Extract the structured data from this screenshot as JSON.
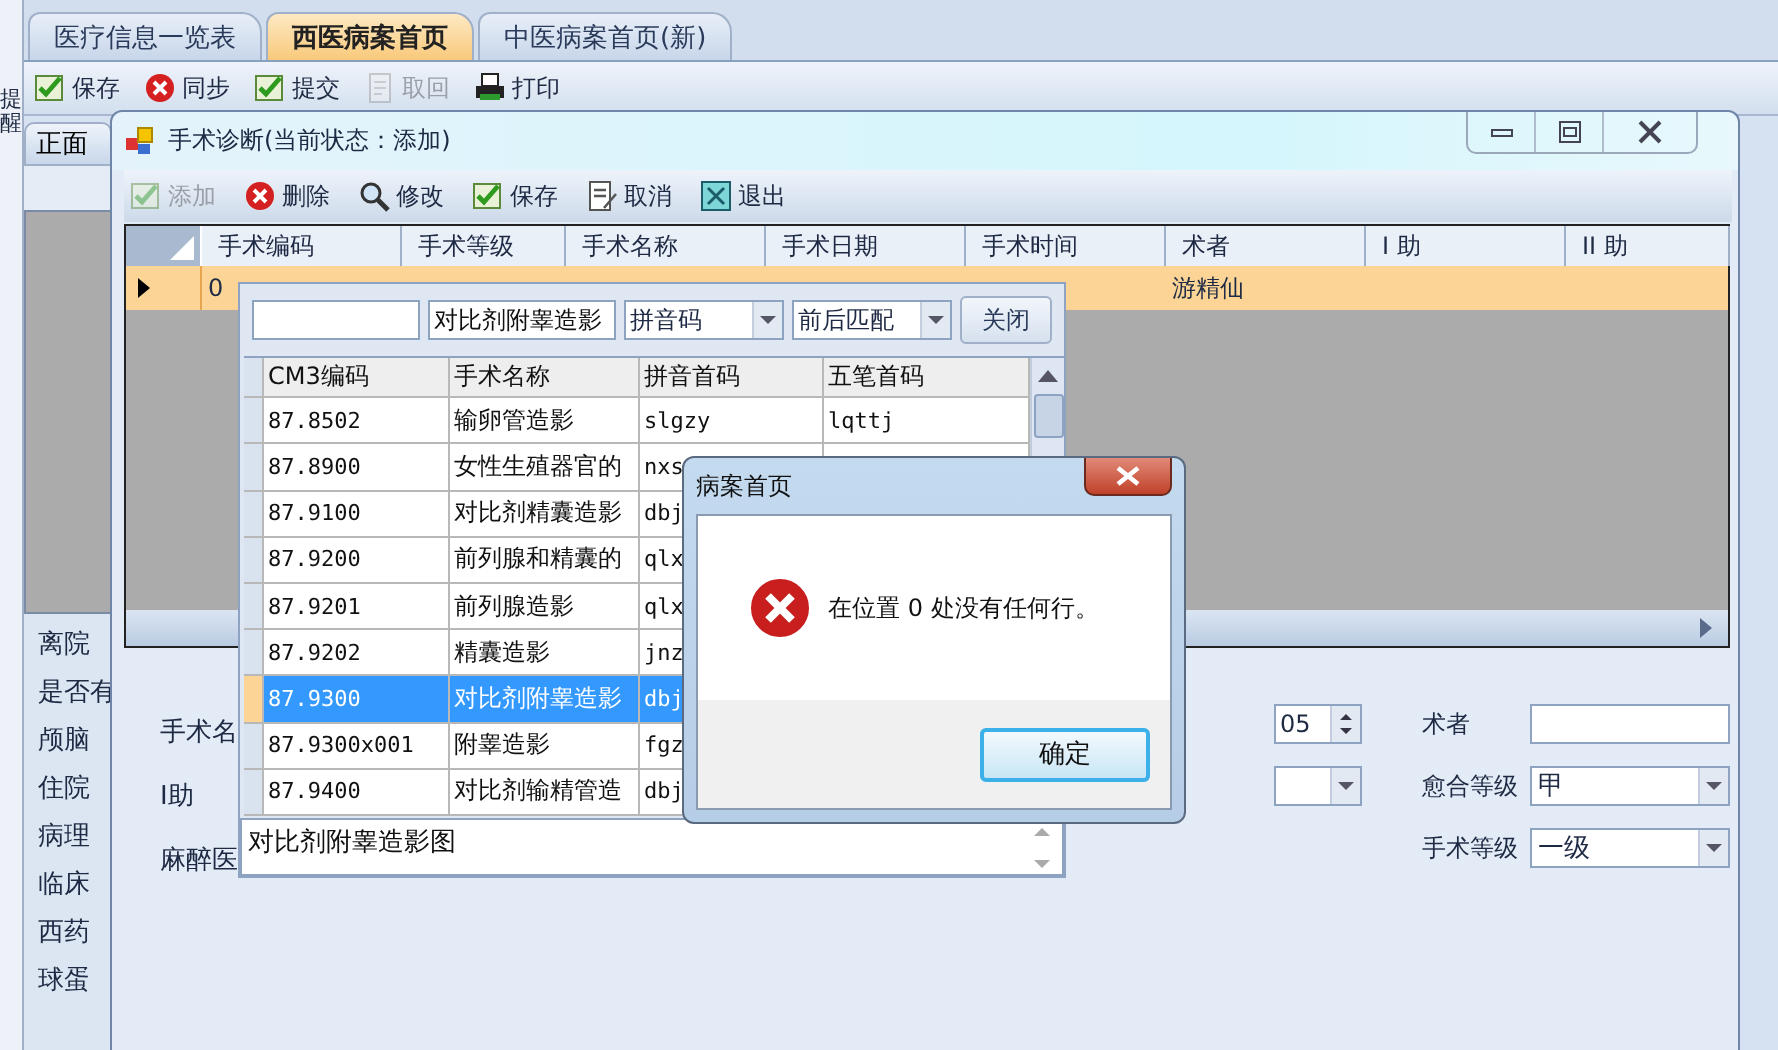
{
  "side_tab": {
    "label": "提醒"
  },
  "tabs": [
    {
      "label": "医疗信息一览表",
      "selected": false
    },
    {
      "label": "西医病案首页",
      "selected": true
    },
    {
      "label": "中医病案首页(新)",
      "selected": false
    }
  ],
  "toolbar": [
    {
      "label": "保存",
      "kind": "check",
      "disabled": false
    },
    {
      "label": "同步",
      "kind": "error",
      "disabled": false
    },
    {
      "label": "提交",
      "kind": "check",
      "disabled": false
    },
    {
      "label": "取回",
      "kind": "doc",
      "disabled": true
    },
    {
      "label": "打印",
      "kind": "print",
      "disabled": false
    }
  ],
  "left_panel": {
    "tab": "正面",
    "labels": [
      "离院",
      "是否有",
      "颅脑",
      "住院",
      "病理",
      "临床",
      "西药",
      "球蛋"
    ]
  },
  "surgery_window": {
    "title": "手术诊断(当前状态：添加)",
    "toolbar": [
      {
        "label": "添加",
        "kind": "check",
        "disabled": true
      },
      {
        "label": "删除",
        "kind": "error",
        "disabled": false
      },
      {
        "label": "修改",
        "kind": "search",
        "disabled": false
      },
      {
        "label": "保存",
        "kind": "check",
        "disabled": false
      },
      {
        "label": "取消",
        "kind": "pencil",
        "disabled": false
      },
      {
        "label": "退出",
        "kind": "exit",
        "disabled": false
      }
    ],
    "grid": {
      "columns": [
        "手术编码",
        "手术等级",
        "手术名称",
        "手术日期",
        "手术时间",
        "术者",
        "I 助",
        "II 助"
      ],
      "rows": [
        {
          "selected": true,
          "cells": [
            "0",
            "",
            "",
            "",
            "",
            "游精仙",
            "",
            ""
          ]
        }
      ]
    },
    "form": {
      "left_labels": [
        "手术名",
        "I助",
        "麻醉医"
      ],
      "spinner_value": "05",
      "right_fields": [
        {
          "label": "术者",
          "kind": "text"
        },
        {
          "label": "愈合等级",
          "kind": "combo",
          "value": "甲"
        },
        {
          "label": "手术等级",
          "kind": "combo",
          "value": "一级"
        }
      ]
    }
  },
  "lookup": {
    "keyword": "对比剂附睾造影",
    "match_field": "拼音码",
    "match_mode": "前后匹配",
    "close_button": "关闭",
    "columns": [
      "CM3编码",
      "手术名称",
      "拼音首码",
      "五笔首码"
    ],
    "rows": [
      {
        "selected": false,
        "cells": [
          "87.8502",
          "输卵管造影",
          "slgzy",
          "lqttj"
        ]
      },
      {
        "selected": false,
        "cells": [
          "87.8900",
          "女性生殖器官的",
          "nxs",
          ""
        ]
      },
      {
        "selected": false,
        "cells": [
          "87.9100",
          "对比剂精囊造影",
          "dbj",
          ""
        ]
      },
      {
        "selected": false,
        "cells": [
          "87.9200",
          "前列腺和精囊的",
          "qlx",
          ""
        ]
      },
      {
        "selected": false,
        "cells": [
          "87.9201",
          "前列腺造影",
          "qlx",
          ""
        ]
      },
      {
        "selected": false,
        "cells": [
          "87.9202",
          "精囊造影",
          "jnz",
          ""
        ]
      },
      {
        "selected": true,
        "cells": [
          "87.9300",
          "对比剂附睾造影",
          "dbj",
          ""
        ]
      },
      {
        "selected": false,
        "cells": [
          "87.9300x001",
          "附睾造影",
          "fgz",
          ""
        ]
      },
      {
        "selected": false,
        "cells": [
          "87.9400",
          "对比剂输精管造",
          "dbj",
          ""
        ]
      }
    ],
    "result": "对比剂附睾造影图"
  },
  "message_box": {
    "title": "病案首页",
    "message": "在位置 0 处没有任何行。",
    "button": "确定"
  }
}
